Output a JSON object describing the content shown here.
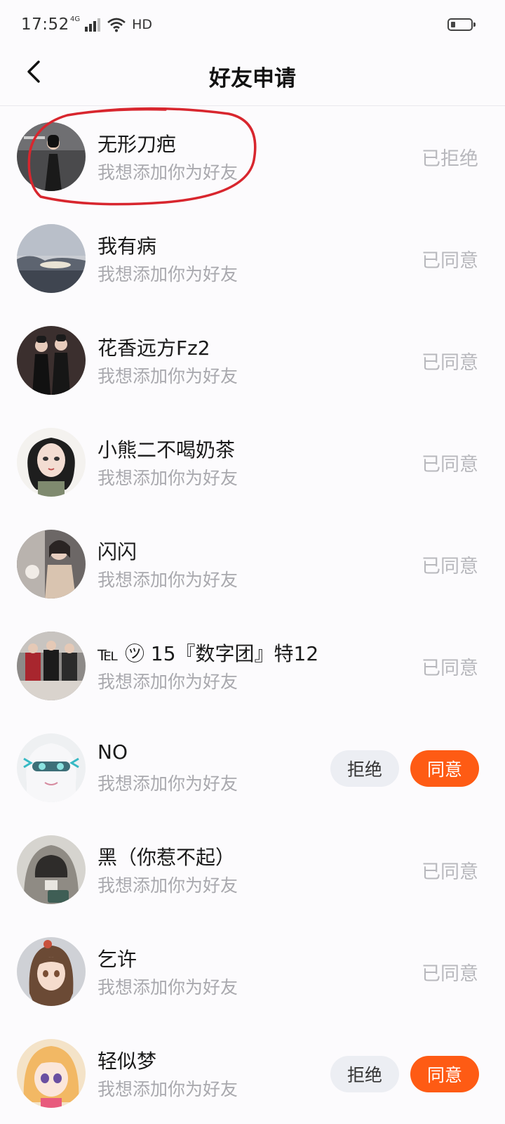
{
  "status_bar": {
    "time": "17:52",
    "network": "4G",
    "hd": "HD",
    "icons": [
      "signal-icon",
      "wifi-icon",
      "battery-icon"
    ]
  },
  "header": {
    "title": "好友申请",
    "back_icon": "chevron-left-icon"
  },
  "colors": {
    "accent": "#fe5b14",
    "reject_bg": "#eceef3",
    "status_text": "#b8b8bd",
    "subtitle": "#a9a9ae",
    "annotation_circle": "#d8262e"
  },
  "requests": [
    {
      "name": "无形刀疤",
      "message": "我想添加你为好友",
      "status": "已拒绝",
      "pending": false
    },
    {
      "name": "我有病",
      "message": "我想添加你为好友",
      "status": "已同意",
      "pending": false
    },
    {
      "name": "花香远方Fz2",
      "message": "我想添加你为好友",
      "status": "已同意",
      "pending": false
    },
    {
      "name": "小熊二不喝奶茶",
      "message": "我想添加你为好友",
      "status": "已同意",
      "pending": false
    },
    {
      "name": "闪闪",
      "message": "我想添加你为好友",
      "status": "已同意",
      "pending": false
    },
    {
      "name": "℡ ㋡ 15『数字团』特12",
      "message": "我想添加你为好友",
      "status": "已同意",
      "pending": false
    },
    {
      "name": "NO",
      "message": "我想添加你为好友",
      "status": "",
      "pending": true,
      "reject_label": "拒绝",
      "accept_label": "同意"
    },
    {
      "name": "黑（你惹不起）",
      "message": "我想添加你为好友",
      "status": "已同意",
      "pending": false
    },
    {
      "name": "乞许",
      "message": "我想添加你为好友",
      "status": "已同意",
      "pending": false
    },
    {
      "name": "轻似梦",
      "message": "我想添加你为好友",
      "status": "",
      "pending": true,
      "reject_label": "拒绝",
      "accept_label": "同意"
    }
  ]
}
